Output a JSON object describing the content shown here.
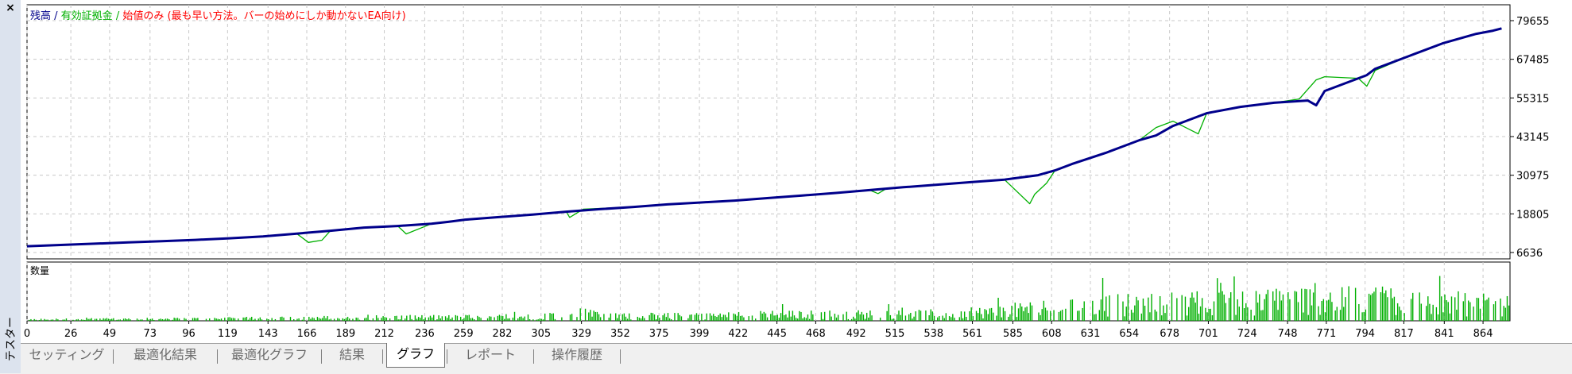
{
  "window": {
    "close_glyph": "×",
    "panel_title": "テスター"
  },
  "colors": {
    "balance": "#00008b",
    "equity": "#00b000",
    "note": "#ff0000",
    "volume": "#00b000",
    "grid": "#c8c8c8",
    "axis": "#000000"
  },
  "tabs": [
    {
      "label": "セッティング",
      "active": false
    },
    {
      "label": "最適化結果",
      "active": false
    },
    {
      "label": "最適化グラフ",
      "active": false
    },
    {
      "label": "結果",
      "active": false
    },
    {
      "label": "グラフ",
      "active": true
    },
    {
      "label": "レポート",
      "active": false
    },
    {
      "label": "操作履歴",
      "active": false
    }
  ],
  "chart_data": [
    {
      "type": "line",
      "legend": [
        {
          "text": "残高",
          "color": "#00008b"
        },
        {
          "text": " / ",
          "color": "#00008b"
        },
        {
          "text": "有効証拠金",
          "color": "#00b000"
        },
        {
          "text": " / ",
          "color": "#00b000"
        },
        {
          "text": "始値のみ (最も早い方法。バーの始めにしか動かないEA向け)",
          "color": "#ff0000"
        }
      ],
      "y_ticks": [
        79655,
        67485,
        55315,
        43145,
        30975,
        18805,
        6636
      ],
      "ylim": [
        6636,
        79655
      ],
      "xlim": [
        0,
        880
      ],
      "grid": true,
      "series": [
        {
          "name": "残高",
          "x": [
            0,
            20,
            40,
            60,
            80,
            100,
            120,
            140,
            160,
            180,
            190,
            200,
            220,
            240,
            250,
            260,
            280,
            300,
            320,
            340,
            360,
            380,
            400,
            420,
            440,
            460,
            480,
            500,
            520,
            540,
            560,
            580,
            600,
            610,
            620,
            640,
            650,
            660,
            670,
            680,
            690,
            700,
            720,
            740,
            760,
            765,
            770,
            790,
            795,
            800,
            820,
            840,
            860,
            870,
            875
          ],
          "y": [
            8600,
            9000,
            9400,
            9800,
            10200,
            10600,
            11100,
            11700,
            12600,
            13500,
            14000,
            14500,
            15000,
            15700,
            16300,
            17000,
            17800,
            18600,
            19500,
            20300,
            21000,
            21800,
            22400,
            23000,
            23800,
            24600,
            25400,
            26300,
            27200,
            28000,
            28800,
            29600,
            31000,
            32500,
            34500,
            38000,
            40000,
            42000,
            43500,
            46500,
            48500,
            50500,
            52500,
            53800,
            54500,
            53000,
            57500,
            61500,
            62500,
            64500,
            68500,
            72500,
            75500,
            76500,
            77200
          ]
        },
        {
          "name": "有効証拠金",
          "x": [
            0,
            40,
            80,
            110,
            120,
            140,
            160,
            167,
            175,
            180,
            190,
            220,
            225,
            240,
            250,
            280,
            300,
            320,
            322,
            330,
            360,
            400,
            440,
            460,
            500,
            505,
            510,
            540,
            560,
            580,
            595,
            598,
            605,
            610,
            620,
            640,
            650,
            660,
            670,
            680,
            695,
            700,
            720,
            740,
            755,
            760,
            765,
            770,
            790,
            795,
            800,
            820,
            840,
            860,
            870,
            875
          ],
          "y": [
            8600,
            9400,
            10200,
            10800,
            11100,
            11700,
            12600,
            9800,
            10500,
            13500,
            14000,
            15000,
            12500,
            15700,
            16300,
            17800,
            18600,
            19500,
            17700,
            20300,
            21000,
            22400,
            23800,
            24600,
            26300,
            25200,
            26800,
            28000,
            28800,
            29600,
            22000,
            25000,
            28500,
            32500,
            34500,
            38000,
            40000,
            42000,
            46000,
            48000,
            44000,
            50500,
            52500,
            53800,
            55000,
            58000,
            61000,
            62000,
            61500,
            59000,
            64000,
            68500,
            72500,
            75500,
            76500,
            77200
          ]
        }
      ]
    },
    {
      "type": "bar",
      "title": "数量",
      "xlim": [
        0,
        880
      ],
      "x_ticks": [
        0,
        26,
        49,
        73,
        96,
        119,
        143,
        166,
        189,
        212,
        236,
        259,
        282,
        305,
        329,
        352,
        375,
        399,
        422,
        445,
        468,
        492,
        515,
        538,
        561,
        585,
        608,
        631,
        654,
        678,
        701,
        724,
        748,
        771,
        794,
        817,
        841,
        864
      ],
      "density_profile": {
        "x": [
          0,
          100,
          200,
          300,
          330,
          340,
          400,
          430,
          500,
          555,
          600,
          650,
          700,
          750,
          800,
          830,
          880
        ],
        "level": [
          0.04,
          0.06,
          0.1,
          0.12,
          0.25,
          0.14,
          0.15,
          0.18,
          0.2,
          0.22,
          0.38,
          0.5,
          0.55,
          0.62,
          0.7,
          0.55,
          0.5
        ]
      }
    }
  ]
}
